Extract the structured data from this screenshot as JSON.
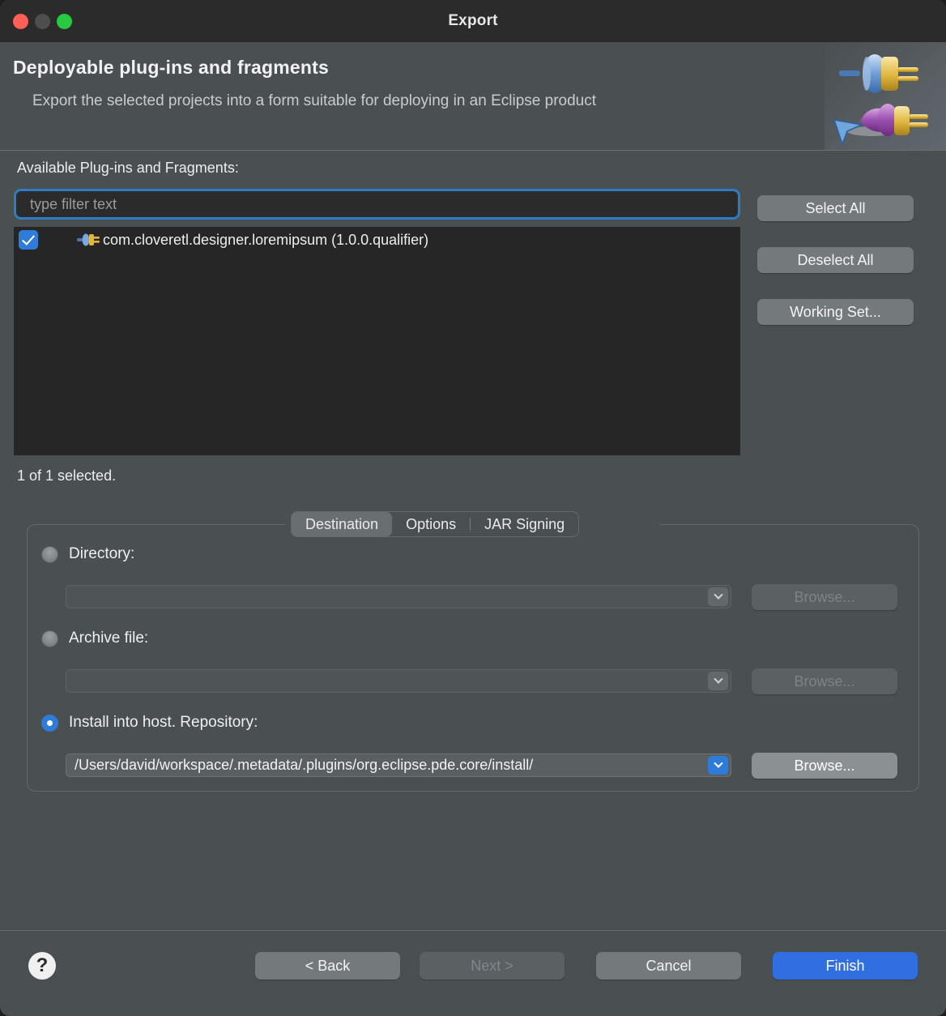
{
  "window": {
    "title": "Export",
    "controls": {
      "close": "close-button",
      "minimize": "minimize-button",
      "maximize": "maximize-button"
    }
  },
  "banner": {
    "title": "Deployable plug-ins and fragments",
    "description": "Export the selected projects into a form suitable for deploying in an Eclipse product"
  },
  "main": {
    "available_label": "Available Plug-ins and Fragments:",
    "filter": {
      "value": "",
      "placeholder": "type filter text"
    },
    "plugins": [
      {
        "label": "com.cloveretl.designer.loremipsum (1.0.0.qualifier)",
        "checked": true
      }
    ],
    "selected_count": "1 of 1 selected.",
    "side_buttons": [
      {
        "label": "Select All",
        "enabled": true
      },
      {
        "label": "Deselect All",
        "enabled": true
      },
      {
        "label": "Working Set...",
        "enabled": true
      }
    ]
  },
  "tabs": [
    {
      "label": "Destination",
      "active": true
    },
    {
      "label": "Options",
      "active": false
    },
    {
      "label": "JAR Signing",
      "active": false
    }
  ],
  "destination": {
    "directory": {
      "label": "Directory:",
      "selected": false,
      "value": "",
      "browse_label": "Browse...",
      "browse_enabled": false
    },
    "archive": {
      "label": "Archive file:",
      "selected": false,
      "value": "",
      "browse_label": "Browse...",
      "browse_enabled": false
    },
    "install_host": {
      "label": "Install into host. Repository:",
      "selected": true,
      "value": "/Users/david/workspace/.metadata/.plugins/org.eclipse.pde.core/install/",
      "browse_label": "Browse...",
      "browse_enabled": true
    }
  },
  "footer": {
    "help_label": "?",
    "buttons": [
      {
        "label": "< Back",
        "state": "normal"
      },
      {
        "label": "Next >",
        "state": "disabled"
      },
      {
        "label": "Cancel",
        "state": "normal"
      },
      {
        "label": "Finish",
        "state": "primary"
      }
    ]
  },
  "colors": {
    "window_background": "#4a4f52",
    "titlebar": "#2b2b2b",
    "list_background": "#262626",
    "accent_blue": "#2f7cd8",
    "primary_button": "#2f6fe0",
    "focus_ring": "#2f7cc4"
  }
}
